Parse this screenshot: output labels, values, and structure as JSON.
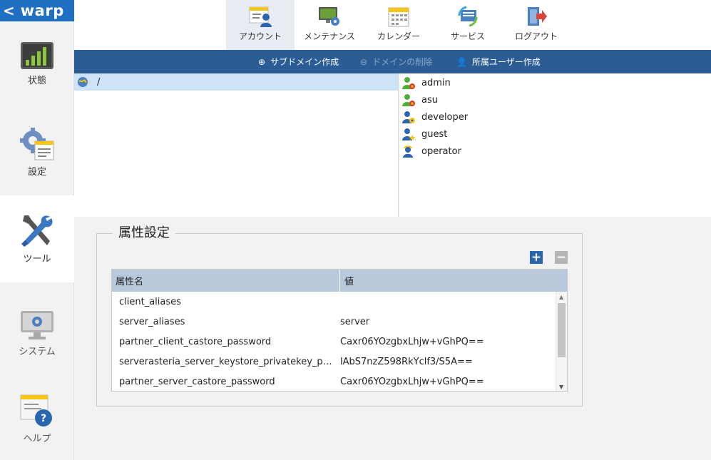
{
  "app": {
    "brand": "warp",
    "back_glyph": "<"
  },
  "sidebar": {
    "items": [
      {
        "label": "状態",
        "icon": "status-chart-icon"
      },
      {
        "label": "設定",
        "icon": "settings-gear-icon"
      },
      {
        "label": "ツール",
        "icon": "tools-icon",
        "active": true
      },
      {
        "label": "システム",
        "icon": "system-monitor-icon"
      },
      {
        "label": "ヘルプ",
        "icon": "help-icon"
      }
    ]
  },
  "toolbar": {
    "items": [
      {
        "label": "アカウント",
        "icon": "account-icon",
        "active": true
      },
      {
        "label": "メンテナンス",
        "icon": "maintenance-icon"
      },
      {
        "label": "カレンダー",
        "icon": "calendar-icon"
      },
      {
        "label": "サービス",
        "icon": "service-icon"
      },
      {
        "label": "ログアウト",
        "icon": "logout-icon"
      }
    ]
  },
  "actions": {
    "create_subdomain": "サブドメイン作成",
    "delete_domain": "ドメインの削除",
    "create_member_user": "所属ユーザー作成"
  },
  "domain_tree": {
    "root": "/"
  },
  "users": [
    {
      "name": "admin",
      "icon": "admin-user-icon"
    },
    {
      "name": "asu",
      "icon": "admin-user-icon"
    },
    {
      "name": "developer",
      "icon": "developer-user-icon"
    },
    {
      "name": "guest",
      "icon": "guest-user-icon"
    },
    {
      "name": "operator",
      "icon": "operator-user-icon"
    }
  ],
  "attributes": {
    "title": "属性設定",
    "add_symbol": "+",
    "remove_symbol": "−",
    "columns": {
      "name": "属性名",
      "value": "値"
    },
    "rows": [
      {
        "name": "client_aliases",
        "value": ""
      },
      {
        "name": "server_aliases",
        "value": "server"
      },
      {
        "name": "partner_client_castore_password",
        "value": "Caxr06YOzgbxLhjw+vGhPQ=="
      },
      {
        "name": "serverasteria_server_keystore_privatekey_password",
        "value": "lAbS7nzZ598RkYclf3/S5A=="
      },
      {
        "name": "partner_server_castore_password",
        "value": "Caxr06YOzgbxLhjw+vGhPQ=="
      }
    ]
  },
  "colors": {
    "brand_blue": "#1f6fc3",
    "action_bar": "#2b5d94",
    "selected_row": "#cfe3f8",
    "table_header": "#b8c9db"
  }
}
